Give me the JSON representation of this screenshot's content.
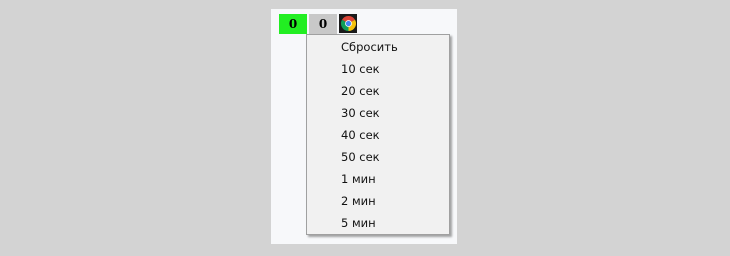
{
  "counters": {
    "green_value": "0",
    "gray_value": "0"
  },
  "icons": {
    "browser": "chrome-icon"
  },
  "colors": {
    "counter_green": "#22ee22",
    "counter_gray": "#c8c8c8",
    "menu_background": "#f1f1f1"
  },
  "menu": {
    "items": [
      {
        "label": "Сбросить"
      },
      {
        "label": "10 сек"
      },
      {
        "label": "20 сек"
      },
      {
        "label": "30 сек"
      },
      {
        "label": "40 сек"
      },
      {
        "label": "50 сек"
      },
      {
        "label": "1 мин"
      },
      {
        "label": "2 мин"
      },
      {
        "label": "5 мин"
      }
    ]
  }
}
